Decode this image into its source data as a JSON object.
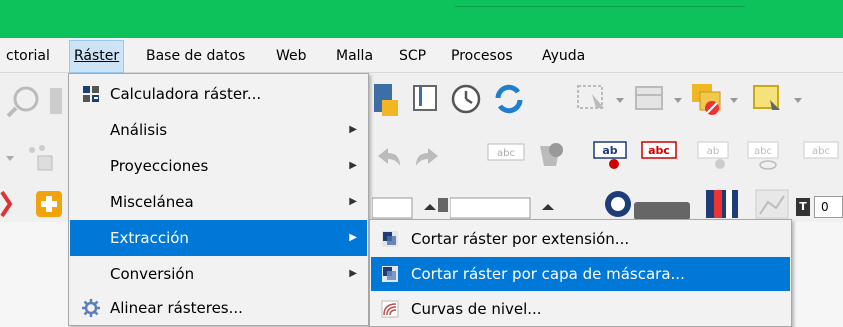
{
  "menubar": {
    "items": [
      {
        "id": "vectorial",
        "label": "ctorial"
      },
      {
        "id": "raster",
        "label": "Ráster"
      },
      {
        "id": "database",
        "label": "Base de datos"
      },
      {
        "id": "web",
        "label": "Web"
      },
      {
        "id": "malla",
        "label": "Malla"
      },
      {
        "id": "scp",
        "label": "SCP"
      },
      {
        "id": "procesos",
        "label": "Procesos"
      },
      {
        "id": "ayuda",
        "label": "Ayuda"
      }
    ]
  },
  "raster_menu": {
    "items": [
      {
        "label": "Calculadora ráster...",
        "icon": "calculator-icon",
        "has_submenu": false
      },
      {
        "label": "Análisis",
        "has_submenu": true
      },
      {
        "label": "Proyecciones",
        "has_submenu": true
      },
      {
        "label": "Miscelánea",
        "has_submenu": true
      },
      {
        "label": "Extracción",
        "has_submenu": true,
        "highlighted": true
      },
      {
        "label": "Conversión",
        "has_submenu": true
      },
      {
        "label": "Alinear rásteres...",
        "icon": "align-rasters-icon",
        "has_submenu": false
      }
    ]
  },
  "extraction_submenu": {
    "items": [
      {
        "label": "Cortar ráster por extensión...",
        "icon": "clip-by-extent-icon"
      },
      {
        "label": "Cortar ráster por capa de máscara...",
        "icon": "clip-by-mask-icon",
        "highlighted": true
      },
      {
        "label": "Curvas de nivel...",
        "icon": "contour-icon"
      }
    ]
  },
  "toolbar": {
    "field_value": "0",
    "text_tool_label": "T",
    "text_label_abc": "abc",
    "text_label_ab": "ab"
  },
  "colors": {
    "titlebar": "#0ec25b",
    "highlight": "#0078d7",
    "menu_bg": "#f2f2f2"
  }
}
